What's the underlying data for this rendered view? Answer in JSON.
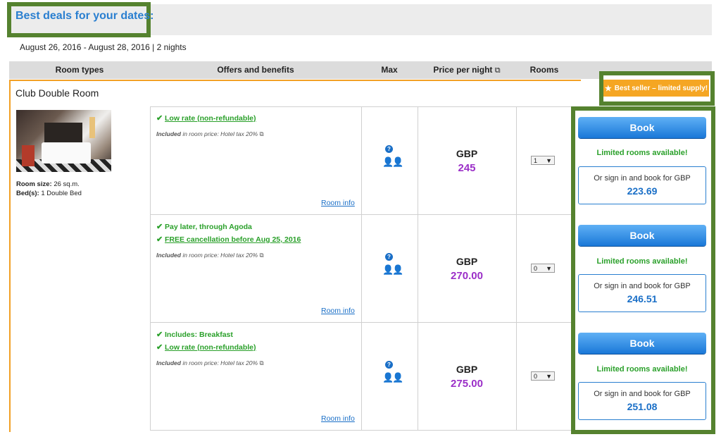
{
  "header": {
    "title": "Best deals for your dates:",
    "dates": "August 26, 2016 - August 28, 2016 | 2 nights"
  },
  "columns": {
    "room_types": "Room types",
    "offers": "Offers and benefits",
    "max": "Max",
    "price": "Price per night",
    "rooms": "Rooms"
  },
  "room": {
    "name": "Club Double Room",
    "badge": "Best seller – limited supply!",
    "size_label": "Room size:",
    "size_value": "26 sq.m.",
    "beds_label": "Bed(s):",
    "beds_value": "1 Double Bed"
  },
  "rows": [
    {
      "offers": [
        "Low rate (non-refundable)"
      ],
      "offers_underlined": [
        true
      ],
      "included_label": "Included",
      "included_text": "in room price: Hotel tax 20%",
      "room_info": "Room info",
      "currency": "GBP",
      "price": "245",
      "rooms_selected": "1",
      "book": "Book",
      "limited": "Limited rooms available!",
      "signin_text": "Or sign in and book for GBP",
      "signin_price": "223.69"
    },
    {
      "offers": [
        "Pay later, through Agoda",
        "FREE cancellation before Aug 25, 2016"
      ],
      "offers_underlined": [
        false,
        true
      ],
      "included_label": "Included",
      "included_text": "in room price: Hotel tax 20%",
      "room_info": "Room info",
      "currency": "GBP",
      "price": "270.00",
      "rooms_selected": "0",
      "book": "Book",
      "limited": "Limited rooms available!",
      "signin_text": "Or sign in and book for GBP",
      "signin_price": "246.51"
    },
    {
      "offers": [
        "Includes: Breakfast",
        "Low rate (non-refundable)"
      ],
      "offers_underlined": [
        false,
        true
      ],
      "included_label": "Included",
      "included_text": "in room price: Hotel tax 20%",
      "room_info": "Room info",
      "currency": "GBP",
      "price": "275.00",
      "rooms_selected": "0",
      "book": "Book",
      "limited": "Limited rooms available!",
      "signin_text": "Or sign in and book for GBP",
      "signin_price": "251.08"
    }
  ],
  "icons": {
    "check": "check-icon",
    "external": "external-link-icon",
    "question": "question-icon",
    "people": "two-guests-icon",
    "star": "star-icon",
    "dropdown": "chevron-down-icon"
  },
  "colors": {
    "accent_blue": "#2a7fd0",
    "price_purple": "#9b2fc8",
    "green": "#2aa02a",
    "orange": "#f2a024",
    "highlight_green": "#55822f"
  }
}
